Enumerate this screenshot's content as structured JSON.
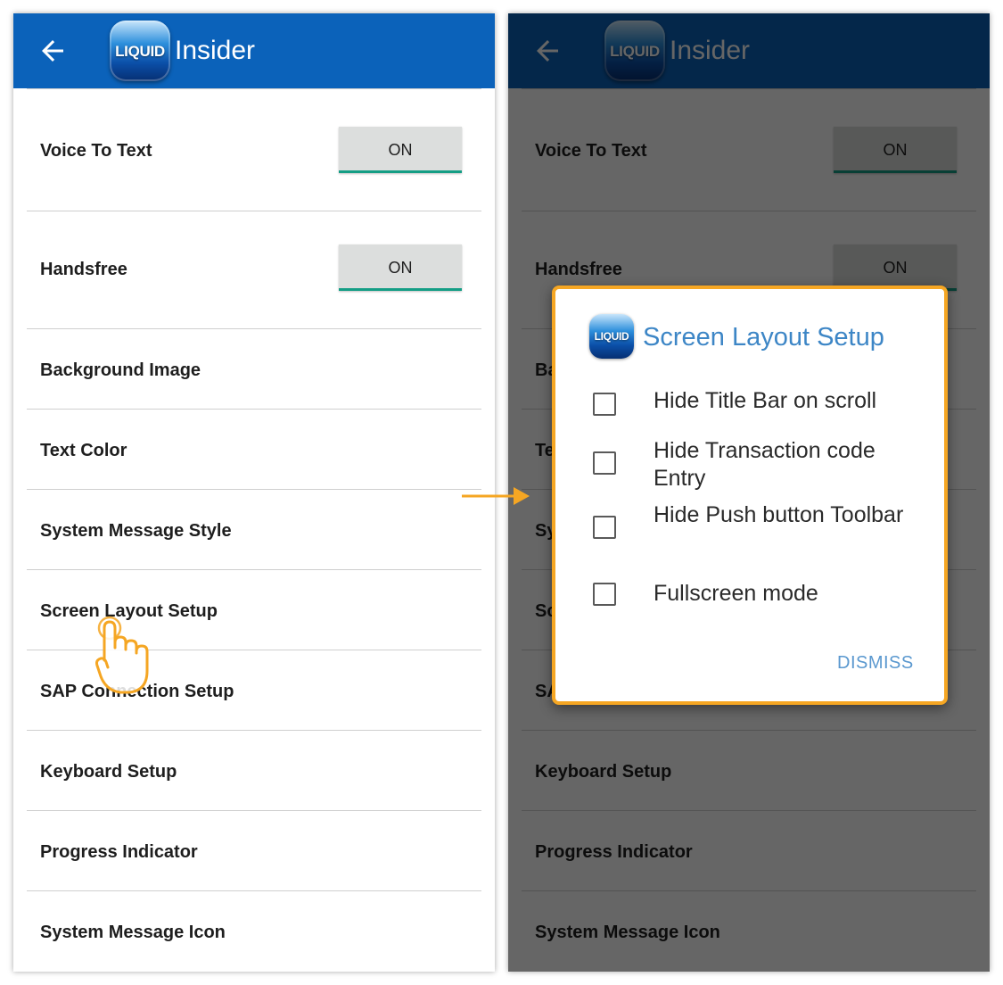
{
  "app": {
    "title": "Insider",
    "logo_text": "LIQUID"
  },
  "settings": [
    {
      "label": "Voice To Text",
      "toggle": "ON"
    },
    {
      "label": "Handsfree",
      "toggle": "ON"
    },
    {
      "label": "Background Image"
    },
    {
      "label": "Text Color"
    },
    {
      "label": "System Message Style"
    },
    {
      "label": "Screen Layout Setup"
    },
    {
      "label": "SAP Connection Setup"
    },
    {
      "label": "Keyboard Setup"
    },
    {
      "label": "Progress Indicator"
    },
    {
      "label": "System Message Icon"
    }
  ],
  "dialog": {
    "logo_text": "LIQUID",
    "title": "Screen Layout Setup",
    "options": [
      {
        "label": "Hide Title Bar on scroll",
        "checked": false
      },
      {
        "label": "Hide Transaction code Entry",
        "checked": false
      },
      {
        "label": "Hide Push button Toolbar",
        "checked": false
      },
      {
        "label": "Fullscreen mode",
        "checked": false
      }
    ],
    "dismiss_label": "DISMISS"
  },
  "colors": {
    "appbar": "#0b62ba",
    "toggle_underline": "#149e85",
    "dialog_title": "#3d86c6",
    "highlight": "#f5a623"
  },
  "icons": [
    "back-arrow-icon",
    "tap-hand-icon",
    "right-arrow-icon",
    "checkbox-icon"
  ]
}
